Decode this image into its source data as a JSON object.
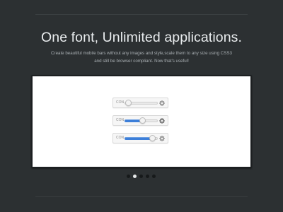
{
  "headline": "One font, Unlimited applications.",
  "description": "Create beautiful mobile bars without any images and style,scale them to any size using CSS3 and still be browser compliant. Now that's useful!",
  "controls": [
    {
      "label": "CON",
      "value": 0.03,
      "icon": "gear-icon"
    },
    {
      "label": "CON",
      "value": 0.55,
      "icon": "gear-icon"
    },
    {
      "label": "CON",
      "value": 0.93,
      "icon": "gear-icon"
    }
  ],
  "pagination": {
    "count": 5,
    "active_index": 1
  },
  "colors": {
    "background": "#2c3032",
    "accent": "#3d7fd9",
    "panel": "#ffffff"
  }
}
